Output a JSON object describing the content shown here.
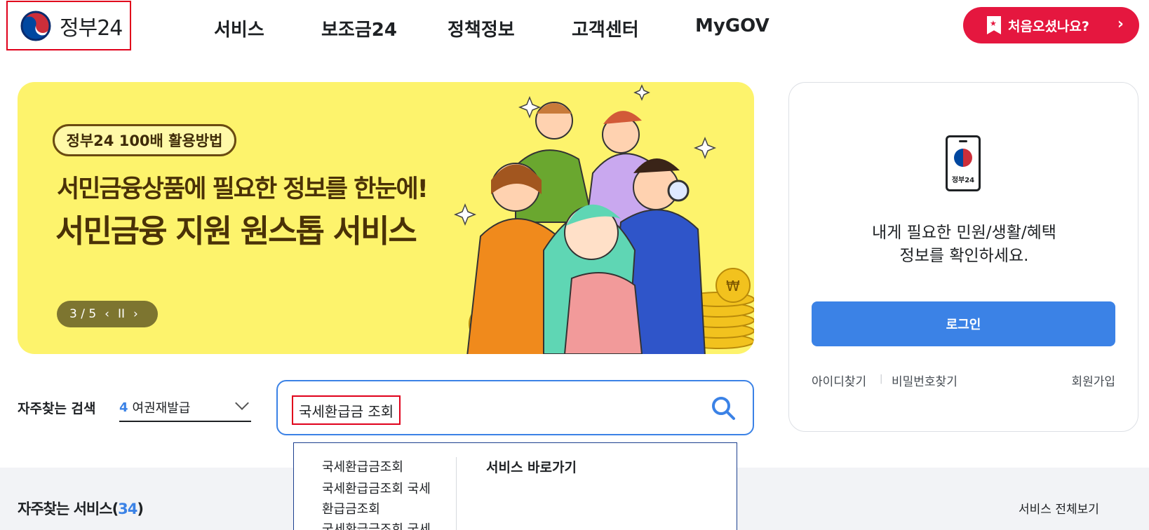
{
  "header": {
    "logo_text": "정부24",
    "nav": [
      "서비스",
      "보조금24",
      "정책정보",
      "고객센터",
      "MyGOV"
    ],
    "first_visit_label": "처음오셨나요?"
  },
  "banner": {
    "tag": "정부24 100배 활용방법",
    "subtitle": "서민금융상품에 필요한 정보를 한눈에!",
    "title": "서민금융 지원 원스톱 서비스",
    "page_indicator": "3 / 5"
  },
  "login": {
    "message_line1": "내게 필요한 민원/생활/혜택",
    "message_line2": "정보를 확인하세요.",
    "phone_label": "정부24",
    "login_button": "로그인",
    "find_id": "아이디찾기",
    "find_password": "비밀번호찾기",
    "signup": "회원가입"
  },
  "frequent_search": {
    "label": "자주찾는 검색",
    "rank": "4",
    "term": "여권재발급"
  },
  "search": {
    "value": "국세환급금 조회",
    "suggestions": [
      "국세환급금조회",
      "국세환급금조회 국세",
      "환급금조회",
      "국세환급금조회 국세"
    ],
    "shortcut_heading": "서비스 바로가기"
  },
  "frequent_services": {
    "label": "자주찾는 서비스",
    "count": "34",
    "view_all": "서비스 전체보기"
  },
  "colors": {
    "accent_blue": "#3b82e6",
    "brand_red": "#e5173f",
    "banner_yellow": "#fdf36c"
  }
}
